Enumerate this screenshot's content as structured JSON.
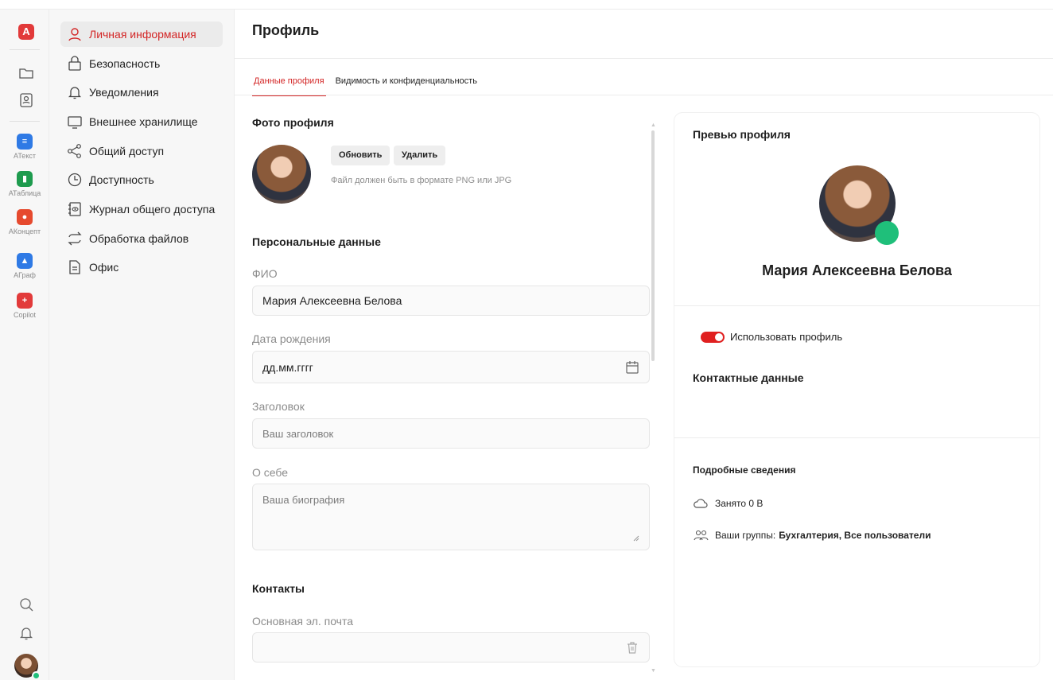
{
  "rail": {
    "apps": [
      {
        "label": "АТекст",
        "color": "#2f7ae5",
        "glyph": "≡"
      },
      {
        "label": "АТаблица",
        "color": "#1e9b4e",
        "glyph": "▮"
      },
      {
        "label": "АКонцепт",
        "color": "#e64a2e",
        "glyph": "●"
      },
      {
        "label": "АГраф",
        "color": "#2f7ae5",
        "glyph": "▲"
      },
      {
        "label": "Copilot",
        "color": "#e23a3a",
        "glyph": "+"
      }
    ]
  },
  "nav": {
    "items": [
      {
        "label": "Личная информация",
        "icon": "user-icon"
      },
      {
        "label": "Безопасность",
        "icon": "lock-icon"
      },
      {
        "label": "Уведомления",
        "icon": "bell-icon"
      },
      {
        "label": "Внешнее хранилище",
        "icon": "monitor-icon"
      },
      {
        "label": "Общий доступ",
        "icon": "share-icon"
      },
      {
        "label": "Доступность",
        "icon": "clock-icon"
      },
      {
        "label": "Журнал общего доступа",
        "icon": "eye-log-icon"
      },
      {
        "label": "Обработка файлов",
        "icon": "sync-icon"
      },
      {
        "label": "Офис",
        "icon": "document-icon"
      }
    ]
  },
  "page": {
    "title": "Профиль",
    "tabs": [
      "Данные профиля",
      "Видимость и конфиденциальность"
    ]
  },
  "form": {
    "photo_heading": "Фото профиля",
    "update_button": "Обновить",
    "delete_button": "Удалить",
    "photo_hint": "Файл должен быть в формате PNG или JPG",
    "personal_heading": "Персональные данные",
    "fio_label": "ФИО",
    "fio_value": "Мария Алексеевна Белова",
    "birth_label": "Дата рождения",
    "birth_placeholder": "дд.мм.гггг",
    "headline_label": "Заголовок",
    "headline_placeholder": "Ваш заголовок",
    "about_label": "О себе",
    "about_placeholder": "Ваша биография",
    "contacts_heading": "Контакты",
    "email_label": "Основная эл. почта",
    "email_value": ""
  },
  "preview": {
    "title": "Превью профиля",
    "name": "Мария Алексеевна Белова",
    "use_profile_label": "Использовать профиль",
    "use_profile_on": true,
    "contacts_heading": "Контактные данные",
    "details_heading": "Подробные сведения",
    "storage_text": "Занято 0 В",
    "groups_prefix": "Ваши группы:",
    "groups_value": "Бухгалтерия, Все пользователи",
    "status_color": "#1fbf7a"
  },
  "colors": {
    "accent": "#d32525"
  }
}
